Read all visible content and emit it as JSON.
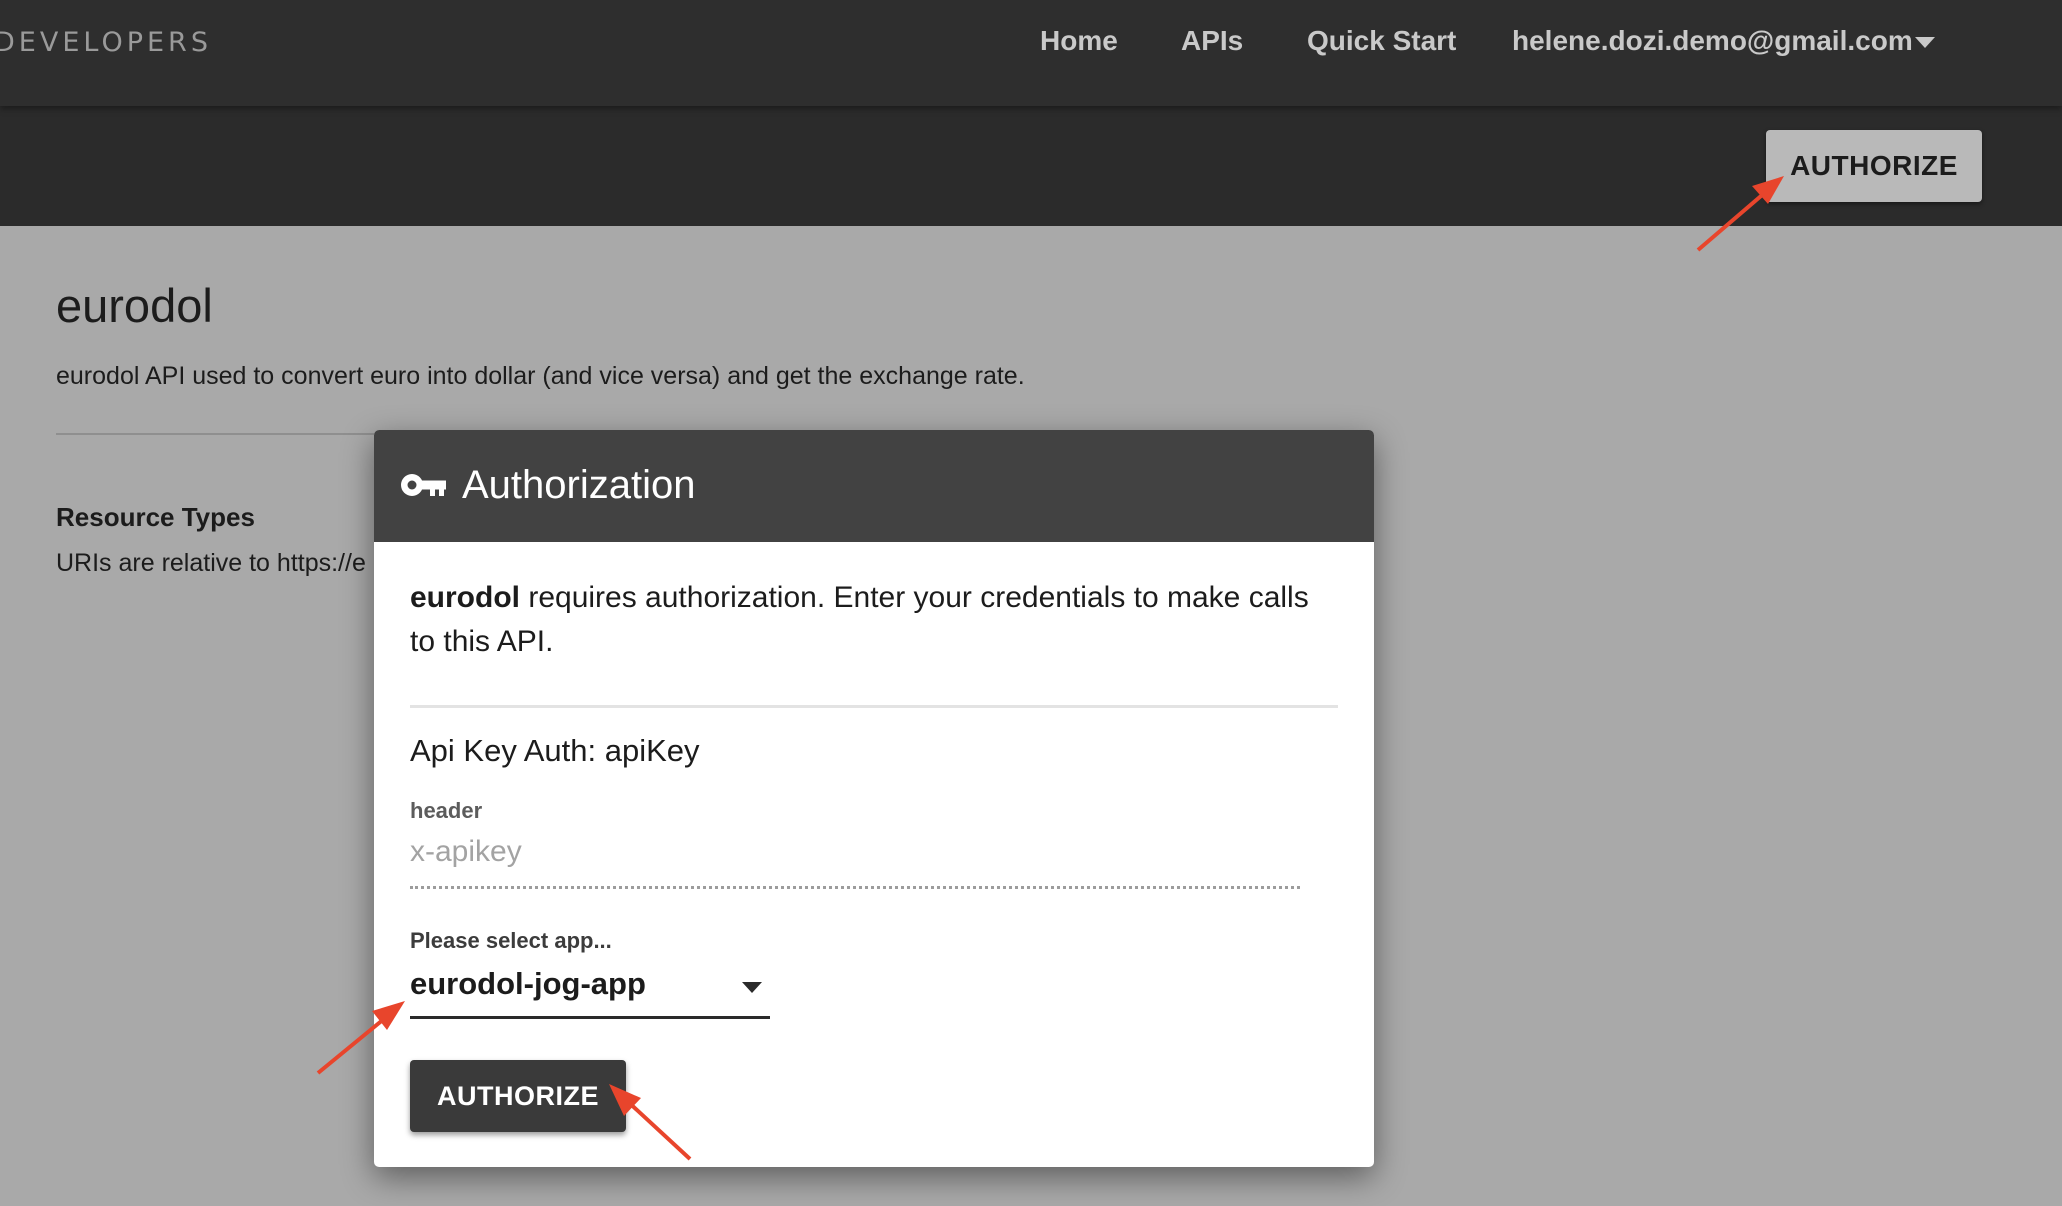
{
  "nav": {
    "brand": "DEVELOPERS",
    "links": [
      "Home",
      "APIs",
      "Quick Start"
    ],
    "user_email": "helene.dozi.demo@gmail.com"
  },
  "header": {
    "authorize_label": "AUTHORIZE"
  },
  "content": {
    "api_title": "eurodol",
    "api_description": "eurodol API used to convert euro into dollar (and vice versa) and get the exchange rate.",
    "resource_types_title": "Resource Types",
    "resource_types_text": "URIs are relative to https://e"
  },
  "modal": {
    "title": "Authorization",
    "intro_api_name": "eurodol",
    "intro_text": " requires authorization. Enter your credentials to make calls to this API.",
    "auth_scheme_label": "Api Key Auth: apiKey",
    "header_label": "header",
    "header_value": "x-apikey",
    "select_label": "Please select app...",
    "selected_app": "eurodol-jog-app",
    "authorize_label": "AUTHORIZE"
  },
  "colors": {
    "nav_background": "#2e2e2e",
    "modal_header": "#424242",
    "annotation_arrow": "#e8452c",
    "overlay_background": "#a9a9a9"
  },
  "icons": {
    "modal_header_icon": "key-icon",
    "user_menu_caret": "chevron-down-icon",
    "select_caret": "chevron-down-icon"
  }
}
